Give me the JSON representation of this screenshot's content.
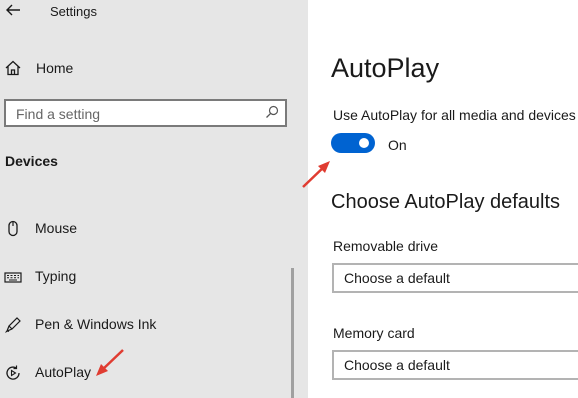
{
  "app": {
    "title": "Settings"
  },
  "sidebar": {
    "home_label": "Home",
    "search_placeholder": "Find a setting",
    "section_heading": "Devices",
    "items": [
      {
        "label": "Mouse",
        "icon": "mouse-icon"
      },
      {
        "label": "Typing",
        "icon": "keyboard-icon"
      },
      {
        "label": "Pen & Windows Ink",
        "icon": "pen-icon"
      },
      {
        "label": "AutoPlay",
        "icon": "autoplay-icon"
      }
    ]
  },
  "main": {
    "title": "AutoPlay",
    "autoplay_setting_label": "Use AutoPlay for all media and devices",
    "toggle_state": "On",
    "toggle_on": true,
    "defaults_heading": "Choose AutoPlay defaults",
    "fields": [
      {
        "label": "Removable drive",
        "value": "Choose a default"
      },
      {
        "label": "Memory card",
        "value": "Choose a default"
      }
    ]
  },
  "colors": {
    "sidebar_bg": "#e6e6e6",
    "accent": "#0063d1",
    "annotation_arrow": "#e03c31"
  }
}
